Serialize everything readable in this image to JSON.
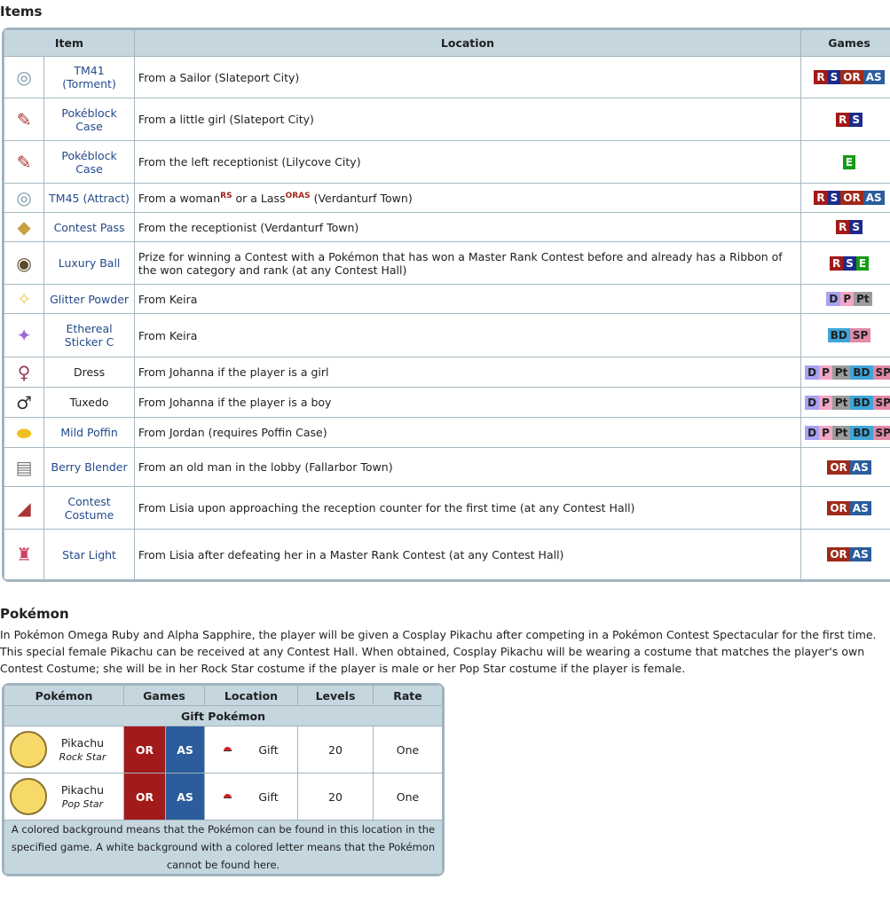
{
  "items_heading": "Items",
  "items_table": {
    "headers": [
      "Item",
      "Location",
      "Games"
    ],
    "rows": [
      {
        "icon": "tm-disc-icon",
        "item": "TM41 (Torment)",
        "location": "From a Sailor (Slateport City)",
        "games": [
          "R",
          "S",
          "OR",
          "AS"
        ]
      },
      {
        "icon": "pokeblock-case-icon",
        "item": "Pokéblock Case",
        "location": "From a little girl (Slateport City)",
        "games": [
          "R",
          "S"
        ]
      },
      {
        "icon": "pokeblock-case-icon",
        "item": "Pokéblock Case",
        "location": "From the left receptionist (Lilycove City)",
        "games": [
          "E"
        ]
      },
      {
        "icon": "tm-disc-icon",
        "item": "TM45 (Attract)",
        "location": "From a woman",
        "loc_sup1": "RS",
        "loc_mid": " or a Lass",
        "loc_sup2": "ORAS",
        "loc_end": " (Verdanturf Town)",
        "games": [
          "R",
          "S",
          "OR",
          "AS"
        ]
      },
      {
        "icon": "contest-pass-icon",
        "item": "Contest Pass",
        "location": "From the receptionist (Verdanturf Town)",
        "games": [
          "R",
          "S"
        ]
      },
      {
        "icon": "luxury-ball-icon",
        "item": "Luxury Ball",
        "location": "Prize for winning a Contest with a Pokémon that has won a Master Rank Contest before and already has a Ribbon of the won category and rank (at any Contest Hall)",
        "games": [
          "R",
          "S",
          "E"
        ]
      },
      {
        "icon": "glitter-powder-icon",
        "item": "Glitter Powder",
        "location": "From Keira",
        "games": [
          "D",
          "P",
          "Pt"
        ]
      },
      {
        "icon": "ethereal-sticker-icon",
        "item": "Ethereal Sticker C",
        "location": "From Keira",
        "games": [
          "BD",
          "SP"
        ]
      },
      {
        "icon": "dress-icon",
        "item": "Dress",
        "location": "From Johanna if the player is a girl",
        "games": [
          "D",
          "P",
          "Pt",
          "BD",
          "SP"
        ]
      },
      {
        "icon": "tuxedo-icon",
        "item": "Tuxedo",
        "location": "From Johanna if the player is a boy",
        "games": [
          "D",
          "P",
          "Pt",
          "BD",
          "SP"
        ]
      },
      {
        "icon": "poffin-icon",
        "item": "Mild Poffin",
        "location": "From Jordan (requires Poffin Case)",
        "games": [
          "D",
          "P",
          "Pt",
          "BD",
          "SP"
        ]
      },
      {
        "icon": "berry-blender-icon",
        "item": "Berry Blender",
        "location": "From an old man in the lobby (Fallarbor Town)",
        "games": [
          "OR",
          "AS"
        ]
      },
      {
        "icon": "contest-costume-icon",
        "item": "Contest Costume",
        "location": "From Lisia upon approaching the reception counter for the first time (at any Contest Hall)",
        "games": [
          "OR",
          "AS"
        ]
      },
      {
        "icon": "star-light-icon",
        "item": "Star Light",
        "location": "From Lisia after defeating her in a Master Rank Contest (at any Contest Hall)",
        "games": [
          "OR",
          "AS"
        ]
      }
    ]
  },
  "pokemon_heading": "Pokémon",
  "intro_text": "In Pokémon Omega Ruby and Alpha Sapphire, the player will be given a Cosplay Pikachu after competing in a Pokémon Contest Spectacular for the first time. This special female Pikachu can be received at any Contest Hall. When obtained, Cosplay Pikachu will be wearing a costume that matches the player's own Contest Costume; she will be in her Rock Star costume if the player is male or her Pop Star costume if the player is female.",
  "pokemon_table": {
    "headers": [
      "Pokémon",
      "Games",
      "Location",
      "Levels",
      "Rate"
    ],
    "subheader": "Gift Pokémon",
    "rows": [
      {
        "name": "Pikachu",
        "form": "Rock Star",
        "game1": "OR",
        "game2": "AS",
        "location": "Gift",
        "level": "20",
        "rate": "One"
      },
      {
        "name": "Pikachu",
        "form": "Pop Star",
        "game1": "OR",
        "game2": "AS",
        "location": "Gift",
        "level": "20",
        "rate": "One"
      }
    ],
    "note": "A colored background means that the Pokémon can be found in this location in the specified game. A white background with a colored letter means that the Pokémon cannot be found here."
  }
}
